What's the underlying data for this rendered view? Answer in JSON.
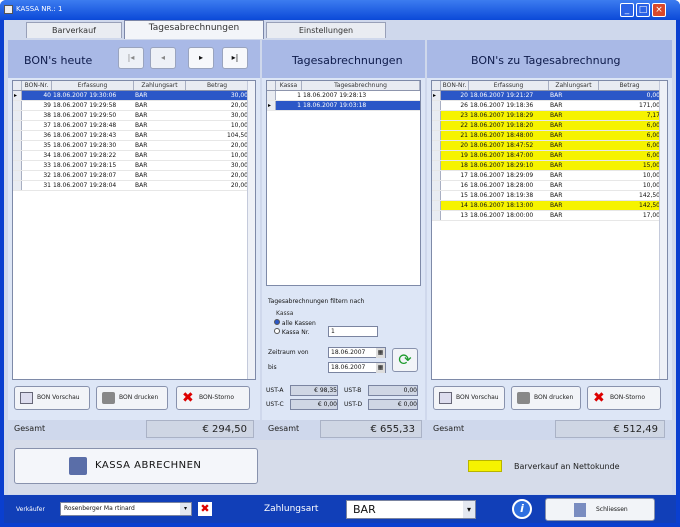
{
  "window": {
    "title": "KASSA NR.: 1"
  },
  "tabs": [
    "Barverkauf",
    "Tagesabrechnungen",
    "Einstellungen"
  ],
  "left": {
    "title": "BON's heute",
    "nav": [
      "|◂",
      "◂",
      "▸",
      "▸|"
    ],
    "columns": [
      "BON-Nr.",
      "Erfassung",
      "Zahlungsart",
      "Betrag"
    ],
    "rows": [
      {
        "nr": "40",
        "time": "18.06.2007 19:30:06",
        "pay": "BAR",
        "amt": "30,00"
      },
      {
        "nr": "39",
        "time": "18.06.2007 19:29:58",
        "pay": "BAR",
        "amt": "20,00"
      },
      {
        "nr": "38",
        "time": "18.06.2007 19:29:50",
        "pay": "BAR",
        "amt": "30,00"
      },
      {
        "nr": "37",
        "time": "18.06.2007 19:28:48",
        "pay": "BAR",
        "amt": "10,00"
      },
      {
        "nr": "36",
        "time": "18.06.2007 19:28:43",
        "pay": "BAR",
        "amt": "104,50"
      },
      {
        "nr": "35",
        "time": "18.06.2007 19:28:30",
        "pay": "BAR",
        "amt": "20,00"
      },
      {
        "nr": "34",
        "time": "18.06.2007 19:28:22",
        "pay": "BAR",
        "amt": "10,00"
      },
      {
        "nr": "33",
        "time": "18.06.2007 19:28:15",
        "pay": "BAR",
        "amt": "30,00"
      },
      {
        "nr": "32",
        "time": "18.06.2007 19:28:07",
        "pay": "BAR",
        "amt": "20,00"
      },
      {
        "nr": "31",
        "time": "18.06.2007 19:28:04",
        "pay": "BAR",
        "amt": "20,00"
      }
    ],
    "btn_preview": "BON Vorschau",
    "btn_print": "BON drucken",
    "btn_storno": "BON-Storno",
    "total_label": "Gesamt",
    "total": "€ 294,50"
  },
  "mid": {
    "title": "Tagesabrechnungen",
    "columns": [
      "Kassa",
      "Tagesabrechnung"
    ],
    "rows": [
      {
        "k": "1",
        "t": "18.06.2007 19:28:13"
      },
      {
        "k": "1",
        "t": "18.06.2007 19:03:18"
      }
    ],
    "filter_title": "Tagesabrechnungen filtern nach",
    "kassa_label": "Kassa",
    "radio_all": "alle Kassen",
    "radio_nr": "Kassa Nr.",
    "kassa_nr": "1",
    "from_label": "Zeitraum von",
    "from": "18.06.2007",
    "to_label": "bis",
    "to": "18.06.2007",
    "sum_labels": [
      "UST-A",
      "UST-B",
      "UST-C",
      "UST-D"
    ],
    "sum_values": [
      "€ 98,35",
      "0,00",
      "€ 0,00",
      "€ 0,00"
    ],
    "total_label": "Gesamt",
    "total": "€ 655,33"
  },
  "right": {
    "title": "BON's zu Tagesabrechnung",
    "columns": [
      "BON-Nr.",
      "Erfassung",
      "Zahlungsart",
      "Betrag"
    ],
    "rows": [
      {
        "nr": "20",
        "time": "18.06.2007 19:21:27",
        "pay": "BAR",
        "amt": "0,00",
        "hl": "sel"
      },
      {
        "nr": "26",
        "time": "18.06.2007 19:18:36",
        "pay": "BAR",
        "amt": "171,00",
        "hl": ""
      },
      {
        "nr": "23",
        "time": "18.06.2007 19:18:29",
        "pay": "BAR",
        "amt": "7,17",
        "hl": "yel"
      },
      {
        "nr": "22",
        "time": "18.06.2007 19:18:20",
        "pay": "BAR",
        "amt": "6,00",
        "hl": "yel"
      },
      {
        "nr": "21",
        "time": "18.06.2007 18:48:00",
        "pay": "BAR",
        "amt": "6,00",
        "hl": "yel"
      },
      {
        "nr": "20",
        "time": "18.06.2007 18:47:52",
        "pay": "BAR",
        "amt": "6,00",
        "hl": "yel"
      },
      {
        "nr": "19",
        "time": "18.06.2007 18:47:00",
        "pay": "BAR",
        "amt": "6,00",
        "hl": "yel"
      },
      {
        "nr": "18",
        "time": "18.06.2007 18:29:10",
        "pay": "BAR",
        "amt": "15,00",
        "hl": "yel"
      },
      {
        "nr": "17",
        "time": "18.06.2007 18:29:09",
        "pay": "BAR",
        "amt": "10,00",
        "hl": ""
      },
      {
        "nr": "16",
        "time": "18.06.2007 18:28:00",
        "pay": "BAR",
        "amt": "10,00",
        "hl": ""
      },
      {
        "nr": "15",
        "time": "18.06.2007 18:19:38",
        "pay": "BAR",
        "amt": "142,50",
        "hl": ""
      },
      {
        "nr": "14",
        "time": "18.06.2007 18:13:00",
        "pay": "BAR",
        "amt": "142,50",
        "hl": "yel"
      },
      {
        "nr": "13",
        "time": "18.06.2007 18:00:00",
        "pay": "BAR",
        "amt": "17,00",
        "hl": ""
      }
    ],
    "btn_preview": "BON Vorschau",
    "btn_print": "BON drucken",
    "btn_storno": "BON-Storno",
    "total_label": "Gesamt",
    "total": "€ 512,49"
  },
  "bill_button": "KASSA ABRECHNEN",
  "legend": {
    "color": "#f6f300",
    "text": "Barverkauf an Nettokunde"
  },
  "bottom": {
    "seller_label": "Verkäufer",
    "seller": "Rosenberger Ma rtinard",
    "payment_label": "Zahlungsart",
    "payment": "BAR",
    "close_label": "Schliessen"
  },
  "icons": {
    "first": "first-record-icon",
    "prev": "prev-record-icon",
    "next": "next-record-icon",
    "last": "last-record-icon",
    "storno": "red-x-icon",
    "refresh": "refresh-icon",
    "info": "info-icon",
    "cash": "cash-register-icon"
  }
}
